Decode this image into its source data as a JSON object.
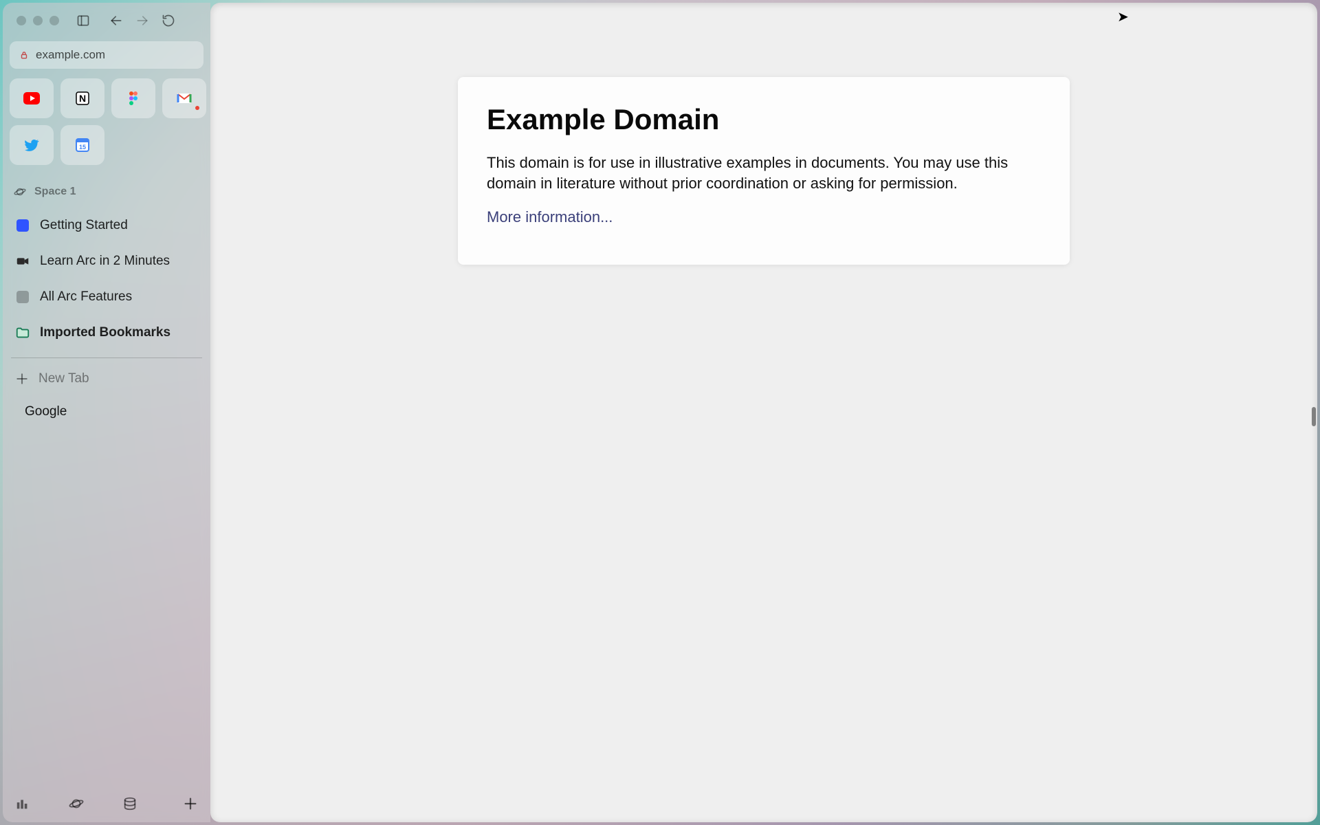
{
  "url_bar": {
    "url_text": "example.com"
  },
  "pinned": [
    {
      "name": "youtube"
    },
    {
      "name": "notion"
    },
    {
      "name": "figma"
    },
    {
      "name": "gmail",
      "has_badge": true
    },
    {
      "name": "twitter"
    },
    {
      "name": "google-calendar",
      "badge_text": "15"
    }
  ],
  "space": {
    "label": "Space 1"
  },
  "sidebar": {
    "items": [
      {
        "label": "Getting Started"
      },
      {
        "label": "Learn Arc in 2 Minutes"
      },
      {
        "label": "All Arc Features"
      },
      {
        "label": "Imported Bookmarks"
      }
    ],
    "new_tab_label": "New Tab",
    "open_tabs": [
      {
        "label": "Google"
      }
    ]
  },
  "page": {
    "title": "Example Domain",
    "body": "This domain is for use in illustrative examples in documents. You may use this domain in literature without prior coordination or asking for permission.",
    "link_text": "More information..."
  }
}
